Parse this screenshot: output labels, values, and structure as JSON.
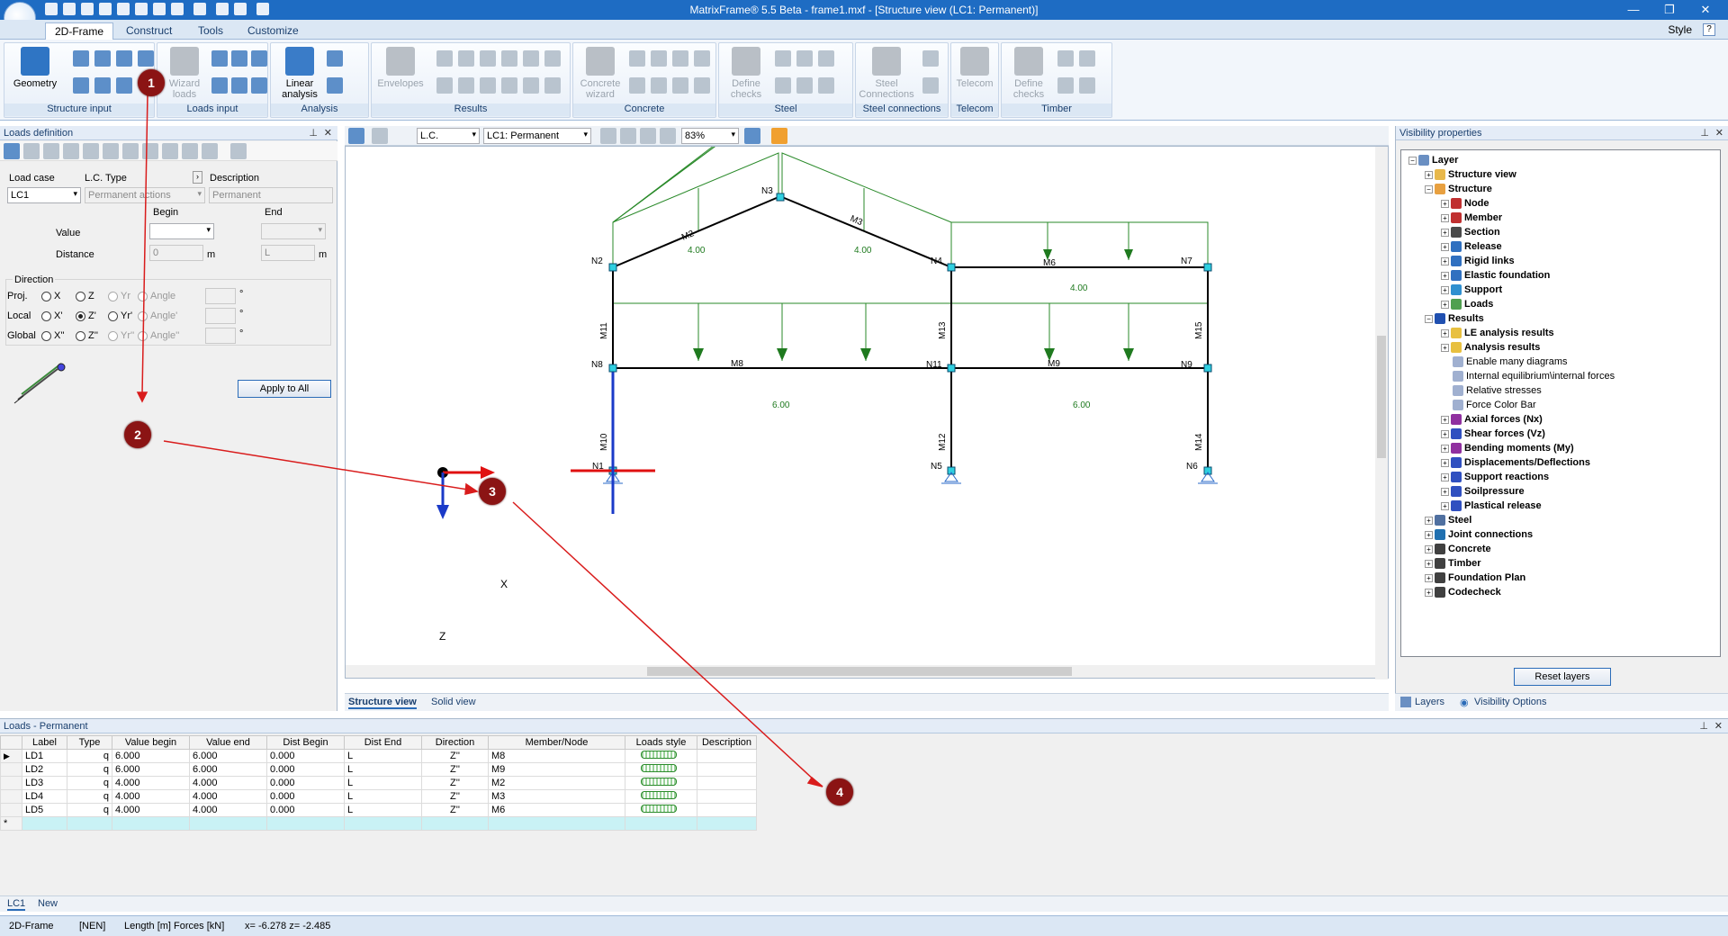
{
  "window": {
    "title": "MatrixFrame® 5.5 Beta - frame1.mxf - [Structure  view (LC1: Permanent)]"
  },
  "ribbon": {
    "tabs": [
      "2D-Frame",
      "Construct",
      "Tools",
      "Customize"
    ],
    "style_label": "Style",
    "groups": {
      "structure_input": "Structure input",
      "loads_input": "Loads input",
      "analysis": "Analysis",
      "results": "Results",
      "concrete": "Concrete",
      "steel": "Steel",
      "steel_connections": "Steel connections",
      "telecom": "Telecom",
      "timber": "Timber"
    },
    "buttons": {
      "geometry": "Geometry",
      "wizard_loads": "Wizard loads",
      "linear_analysis": "Linear analysis",
      "envelopes": "Envelopes",
      "concrete_wizard": "Concrete wizard",
      "define_checks": "Define checks",
      "steel_connections": "Steel Connections",
      "telecom": "Telecom",
      "define_checks_timber": "Define checks"
    }
  },
  "loads_definition": {
    "title": "Loads definition",
    "load_case_label": "Load case",
    "lc_type_label": "L.C. Type",
    "description_label": "Description",
    "load_case_value": "LC1",
    "lc_type_value": "Permanent actions",
    "description_value": "Permanent",
    "begin_label": "Begin",
    "end_label": "End",
    "value_label": "Value",
    "distance_label": "Distance",
    "begin_distance": "0",
    "end_distance": "L",
    "unit_m": "m",
    "direction_label": "Direction",
    "proj_label": "Proj.",
    "local_label": "Local",
    "global_label": "Global",
    "opt_x": "X",
    "opt_z": "Z",
    "opt_yr": "Yr",
    "opt_angle": "Angle",
    "opt_x1": "X'",
    "opt_z1": "Z'",
    "opt_yr1": "Yr'",
    "opt_angle1": "Angle'",
    "opt_x2": "X''",
    "opt_z2": "Z''",
    "opt_yr2": "Yr''",
    "opt_angle2": "Angle''",
    "deg": "°",
    "apply_all": "Apply to All"
  },
  "view_toolbar": {
    "lc_selector": "L.C.",
    "lc_value": "LC1: Permanent",
    "zoom": "83%"
  },
  "structure": {
    "nodes": [
      "N1",
      "N2",
      "N3",
      "N4",
      "N5",
      "N6",
      "N7",
      "N8",
      "N9",
      "N11"
    ],
    "members": [
      "M2",
      "M3",
      "M6",
      "M8",
      "M9",
      "M10",
      "M11",
      "M12",
      "M13",
      "M14",
      "M15"
    ],
    "load_values": [
      "4.00",
      "4.00",
      "4.00",
      "6.00",
      "6.00"
    ],
    "axis_x": "X",
    "axis_z": "Z"
  },
  "view_tabs": [
    "Structure  view",
    "Solid view"
  ],
  "visibility": {
    "title": "Visibility properties",
    "tree": [
      {
        "label": "Layer",
        "bold": true,
        "depth": 0,
        "color": "#6a8fc2"
      },
      {
        "label": "Structure view",
        "bold": true,
        "depth": 1,
        "color": "#e8b84b"
      },
      {
        "label": "Structure",
        "bold": true,
        "depth": 1,
        "color": "#e8a040"
      },
      {
        "label": "Node",
        "bold": true,
        "depth": 2,
        "color": "#c03030"
      },
      {
        "label": "Member",
        "bold": true,
        "depth": 2,
        "color": "#c03030"
      },
      {
        "label": "Section",
        "bold": true,
        "depth": 2,
        "color": "#4a4a4a"
      },
      {
        "label": "Release",
        "bold": true,
        "depth": 2,
        "color": "#3070c0"
      },
      {
        "label": "Rigid links",
        "bold": true,
        "depth": 2,
        "color": "#3070c0"
      },
      {
        "label": "Elastic foundation",
        "bold": true,
        "depth": 2,
        "color": "#3070c0"
      },
      {
        "label": "Support",
        "bold": true,
        "depth": 2,
        "color": "#3090d0"
      },
      {
        "label": "Loads",
        "bold": true,
        "depth": 2,
        "color": "#50a050"
      },
      {
        "label": "Results",
        "bold": true,
        "depth": 1,
        "color": "#2050b0"
      },
      {
        "label": "LE analysis results",
        "bold": true,
        "depth": 2,
        "color": "#e8c040"
      },
      {
        "label": "Analysis results",
        "bold": true,
        "depth": 2,
        "color": "#e8c040"
      },
      {
        "label": "Enable many diagrams",
        "bold": false,
        "depth": 2,
        "color": "#a0b0d0"
      },
      {
        "label": "Internal equilibrium\\internal forces",
        "bold": false,
        "depth": 2,
        "color": "#a0b0d0"
      },
      {
        "label": "Relative stresses",
        "bold": false,
        "depth": 2,
        "color": "#a0b0d0"
      },
      {
        "label": "Force Color Bar",
        "bold": false,
        "depth": 2,
        "color": "#a0b0d0"
      },
      {
        "label": "Axial forces (Nx)",
        "bold": true,
        "depth": 2,
        "color": "#9030a0"
      },
      {
        "label": "Shear forces (Vz)",
        "bold": true,
        "depth": 2,
        "color": "#3050c0"
      },
      {
        "label": "Bending moments (My)",
        "bold": true,
        "depth": 2,
        "color": "#9030a0"
      },
      {
        "label": "Displacements/Deflections",
        "bold": true,
        "depth": 2,
        "color": "#3050c0"
      },
      {
        "label": "Support reactions",
        "bold": true,
        "depth": 2,
        "color": "#3050c0"
      },
      {
        "label": "Soilpressure",
        "bold": true,
        "depth": 2,
        "color": "#3050c0"
      },
      {
        "label": "Plastical release",
        "bold": true,
        "depth": 2,
        "color": "#3050c0"
      },
      {
        "label": "Steel",
        "bold": true,
        "depth": 1,
        "color": "#5070a0"
      },
      {
        "label": "Joint connections",
        "bold": true,
        "depth": 1,
        "color": "#2070b0"
      },
      {
        "label": "Concrete",
        "bold": true,
        "depth": 1,
        "color": "#404040"
      },
      {
        "label": "Timber",
        "bold": true,
        "depth": 1,
        "color": "#404040"
      },
      {
        "label": "Foundation Plan",
        "bold": true,
        "depth": 1,
        "color": "#404040"
      },
      {
        "label": "Codecheck",
        "bold": true,
        "depth": 1,
        "color": "#404040"
      }
    ],
    "reset_button": "Reset layers",
    "tab_layers": "Layers",
    "tab_options": "Visibility Options"
  },
  "loads_table": {
    "title": "Loads  - Permanent",
    "columns": [
      "Label",
      "Type",
      "Value begin",
      "Value end",
      "Dist Begin",
      "Dist End",
      "Direction",
      "Member/Node",
      "Loads style",
      "Description"
    ],
    "rows": [
      [
        "LD1",
        "q",
        "6.000",
        "6.000",
        "0.000",
        "L",
        "Z''",
        "M8",
        "",
        ""
      ],
      [
        "LD2",
        "q",
        "6.000",
        "6.000",
        "0.000",
        "L",
        "Z''",
        "M9",
        "",
        ""
      ],
      [
        "LD3",
        "q",
        "4.000",
        "4.000",
        "0.000",
        "L",
        "Z''",
        "M2",
        "",
        ""
      ],
      [
        "LD4",
        "q",
        "4.000",
        "4.000",
        "0.000",
        "L",
        "Z''",
        "M3",
        "",
        ""
      ],
      [
        "LD5",
        "q",
        "4.000",
        "4.000",
        "0.000",
        "L",
        "Z''",
        "M6",
        "",
        ""
      ]
    ],
    "new_row_marker": "*",
    "bottom_tabs": [
      "LC1",
      "New"
    ]
  },
  "statusbar": {
    "mode": "2D-Frame",
    "norm": "[NEN]",
    "units": "Length [m] Forces [kN]",
    "coords": "x=   -6.278 z=    -2.485"
  },
  "markers": [
    "1",
    "2",
    "3",
    "4"
  ]
}
